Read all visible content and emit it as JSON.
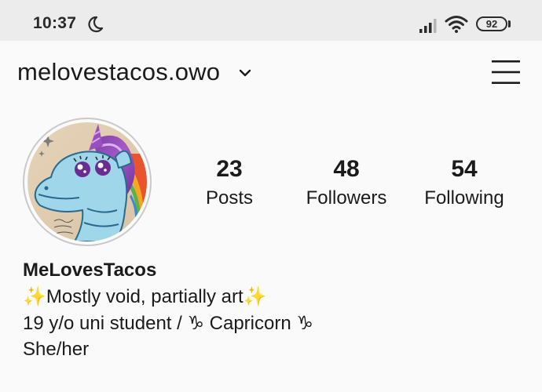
{
  "status_bar": {
    "time": "10:37",
    "battery": "92"
  },
  "profile": {
    "username": "melovestacos.owo",
    "display_name": "MeLovesTacos",
    "stats": [
      {
        "value": "23",
        "label": "Posts"
      },
      {
        "value": "48",
        "label": "Followers"
      },
      {
        "value": "54",
        "label": "Following"
      }
    ],
    "bio": [
      "✨Mostly void, partially art✨",
      "19 y/o uni student / ♑ Capricorn ♑",
      "She/her"
    ]
  },
  "icons": {
    "status": [
      "moon-icon",
      "signal-icon",
      "wifi-icon",
      "battery-icon"
    ],
    "header": [
      "chevron-down-icon",
      "menu-icon"
    ]
  },
  "colors": {
    "background": "#fafafa",
    "status_bar": "#ececec",
    "text": "#1b1b1b",
    "avatar_ring": "#c9c9c9"
  }
}
